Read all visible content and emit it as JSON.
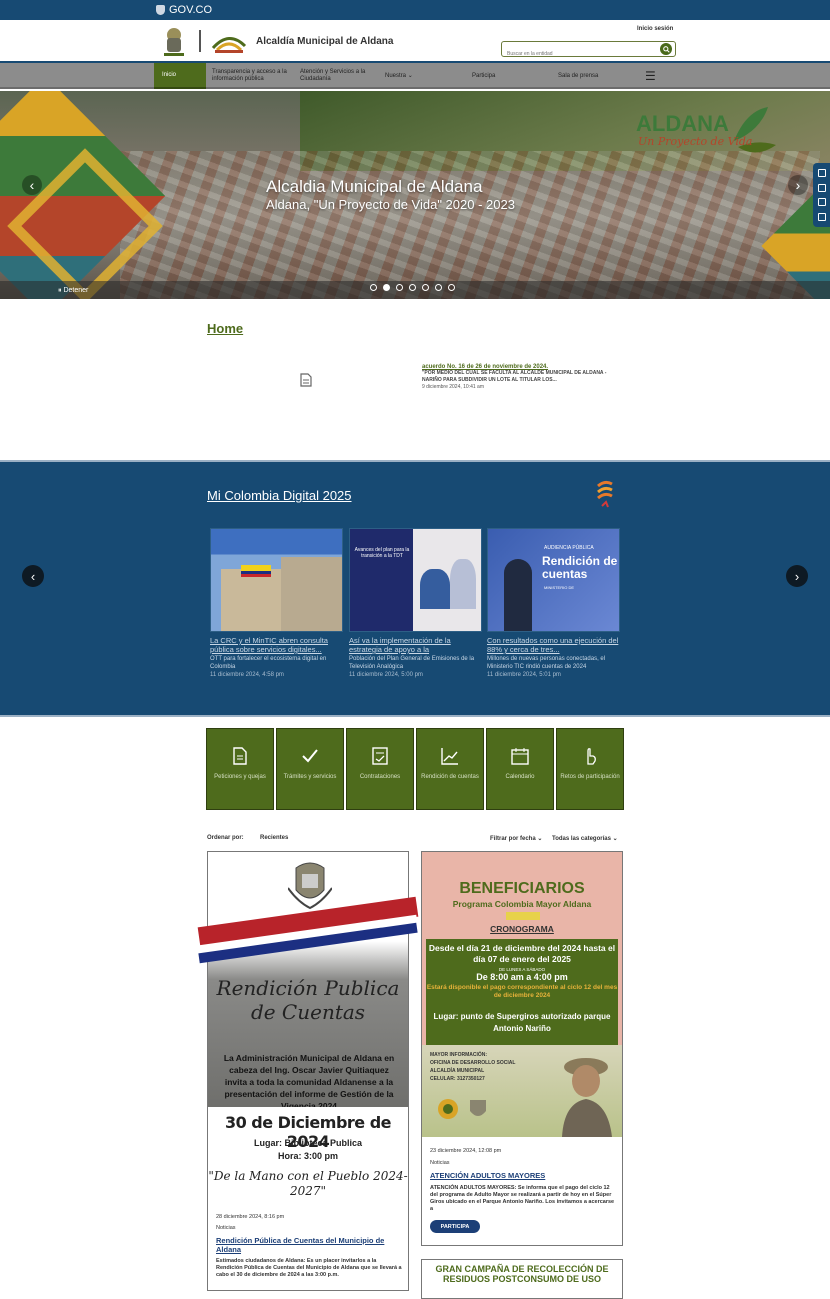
{
  "gov": {
    "label": "GOV.CO"
  },
  "header": {
    "site_title": "Alcaldía Municipal de Aldana",
    "login": "Inicio sesión"
  },
  "search": {
    "placeholder": "Buscar en la entidad"
  },
  "nav": {
    "home": "Inicio",
    "items": [
      "Transparencia y acceso a la información pública",
      "Atención y Servicios a la Ciudadanía",
      "Nuestra",
      "Participa",
      "Sala de prensa"
    ]
  },
  "hero": {
    "title": "Alcaldia Municipal de Aldana",
    "subtitle": "Aldana, \"Un Proyecto de Vida\" 2020 - 2023",
    "brand_line1": "ALDANA",
    "brand_line2": "Un Proyecto de Vida",
    "stop": "Detener",
    "slides": 7,
    "active_slide": 2
  },
  "home": {
    "title": "Home",
    "acuerdo": {
      "title": "acuerdo No. 16 de 26 de noviembre de 2024.",
      "desc": "\"POR MEDIO DEL CUAL SE FACULTA AL ALCALDE MUNICIPAL DE ALDANA -NARIÑO PARA SUBDIVIDIR UN LOTE AL TITULAR LOS...",
      "date": "9 diciembre 2024, 10:41 am"
    }
  },
  "mcd": {
    "title": "Mi Colombia Digital 2025",
    "cards": [
      {
        "title": "La CRC y el MinTIC abren consulta pública sobre servicios digitales...",
        "desc": "OTT para fortalecer el ecosistema digital en Colombia",
        "date": "11 diciembre 2024, 4:58 pm"
      },
      {
        "title": "Así va la implementación de la estrategia de apoyo a la",
        "desc": "Población del Plan General de Emisiones de la Televisión Analógica",
        "date": "11 diciembre 2024, 5:00 pm",
        "img_text": "Avances del plan para la transición a la TDT"
      },
      {
        "title": "Con resultados como una ejecución del 88% y cerca de tres...",
        "desc": "Millones de nuevas personas conectadas, el Ministerio TIC rindió cuentas de 2024",
        "date": "11 diciembre 2024, 5:01 pm",
        "img_text1": "AUDIENCIA PÚBLICA",
        "img_text2": "Rendición de cuentas",
        "img_text3": "MINISTERIO DE"
      }
    ]
  },
  "quick_links": [
    {
      "icon": "document-icon",
      "label": "Peticiones y quejas"
    },
    {
      "icon": "check-icon",
      "label": "Trámites y servicios"
    },
    {
      "icon": "contract-icon",
      "label": "Contrataciones"
    },
    {
      "icon": "chart-icon",
      "label": "Rendición de cuentas"
    },
    {
      "icon": "calendar-icon",
      "label": "Calendario"
    },
    {
      "icon": "hand-icon",
      "label": "Retos de participación"
    }
  ],
  "sort": {
    "label": "Ordenar por:",
    "value": "Recientes",
    "filter_date": "Filtrar por fecha",
    "filter_cat": "Todas las categorías"
  },
  "posts": [
    {
      "poster": {
        "script": "Rendición Publica de Cuentas",
        "invite": "La Administración Municipal de Aldana en cabeza del Ing. Oscar Javier Quitiaquez invita a toda la comunidad Aldanense a la presentación del informe de Gestión de la Vigencia 2024",
        "date": "30 de Diciembre de 2024",
        "place": "Lugar: Biblioteca Publica",
        "hour": "Hora: 3:00 pm",
        "slogan": "\"De la Mano con el Pueblo 2024-2027\""
      },
      "date": "28 diciembre 2024, 8:16 pm",
      "category": "Noticias",
      "title": "Rendición Pública de Cuentas del Municipio de Aldana",
      "desc": "Estimados ciudadanos de Aldana: Es un placer invitarlos a la Rendición Pública de Cuentas del Municipio de Aldana que se llevará a cabo el 30 de diciembre de 2024 a las 3:00 p.m."
    },
    {
      "poster": {
        "h1": "BENEFICIARIOS",
        "h2": "Programa Colombia Mayor Aldana",
        "h3": "CRONOGRAMA",
        "a": "Desde el día 21 de diciembre del 2024 hasta el día 07 de enero del 2025",
        "b": "DE LUNES A SÁBADO",
        "c": "De 8:00 am a 4:00 pm",
        "d": "Estará disponible el pago correspondiente al ciclo 12 del mes de diciembre 2024",
        "place": "Lugar: punto de Supergiros autorizado parque Antonio Nariño",
        "info1": "MAYOR INFORMACIÓN:",
        "info2": "OFICINA DE DESARROLLO SOCIAL",
        "info3": "ALCALDÍA MUNICIPAL",
        "info4": "CELULAR: 3127350127"
      },
      "date": "23 diciembre 2024, 12:08 pm",
      "category": "Noticias",
      "title": "ATENCIÓN ADULTOS MAYORES",
      "desc": "ATENCIÓN ADULTOS MAYORES: Se informa que el pago del ciclo 12 del programa de Adulto Mayor se realizará a partir de hoy en el Súper Giros ubicado en el Parque Antonio Nariño. Los invitamos a acercarse a",
      "button": "PARTICIPA"
    },
    {
      "title": "GRAN CAMPAÑA DE RECOLECCIÓN DE RESIDUOS POSTCONSUMO DE USO"
    }
  ],
  "colors": {
    "gov_blue": "#174a73",
    "green": "#4e6b1c",
    "nav_gray": "#8c8c8c",
    "link_blue": "#1c3f77"
  }
}
